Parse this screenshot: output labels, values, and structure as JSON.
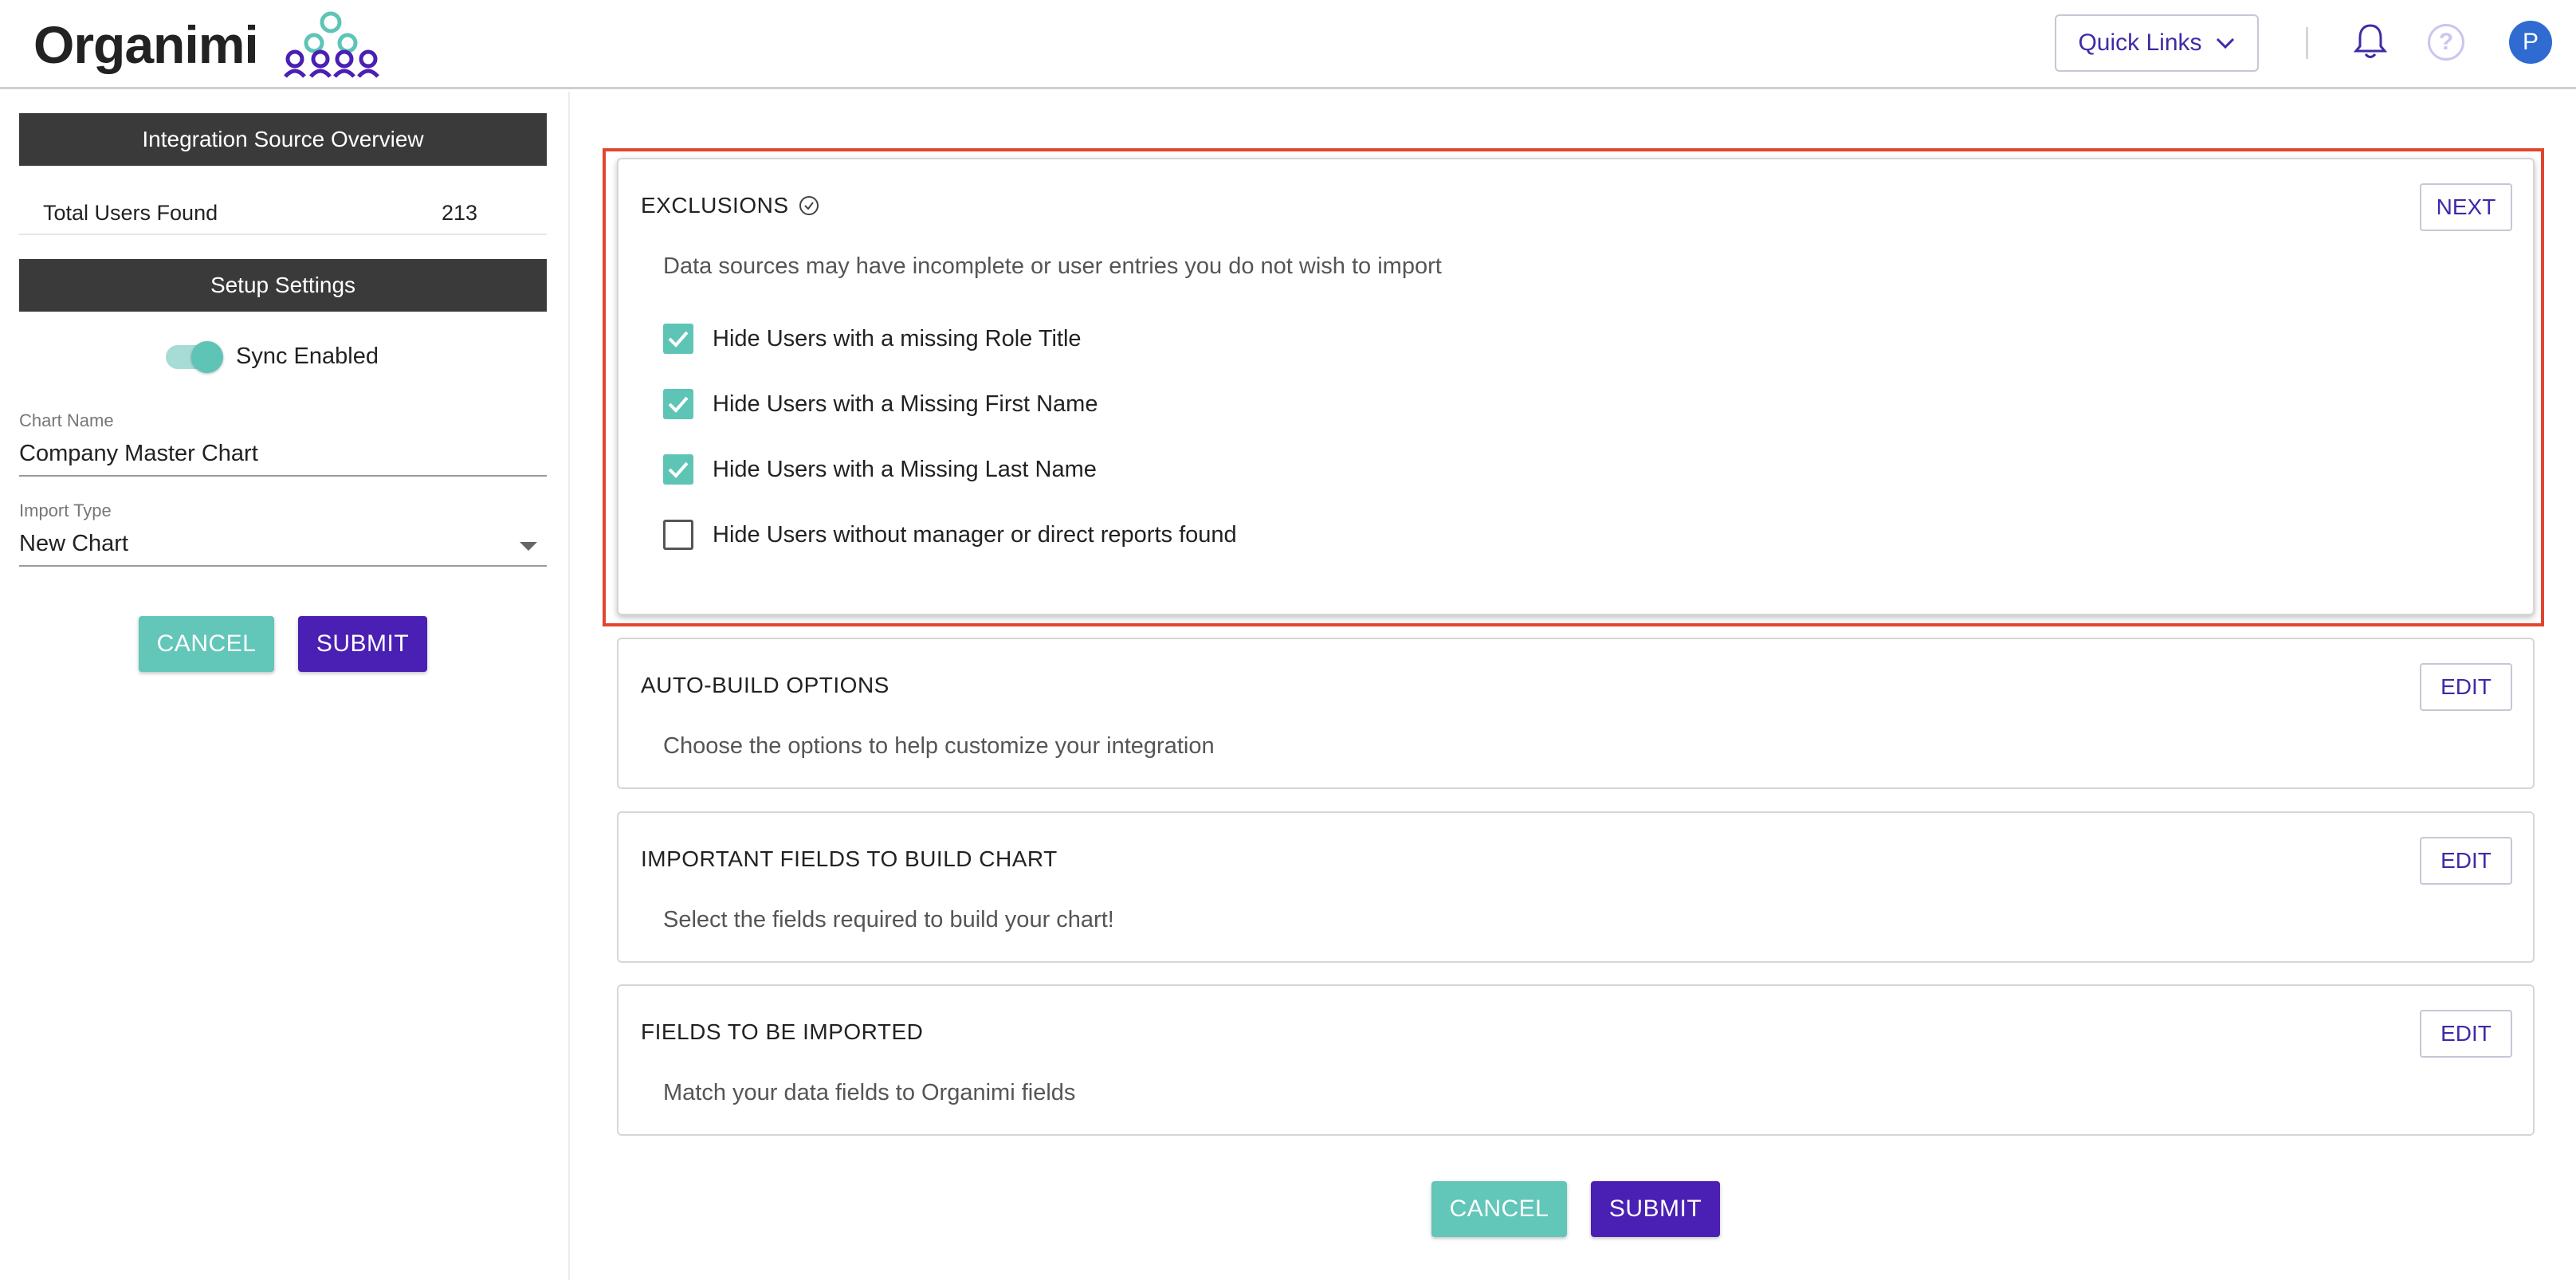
{
  "header": {
    "app_name": "Organimi",
    "quick_links_label": "Quick Links",
    "avatar_initial": "P",
    "help_glyph": "?"
  },
  "sidebar": {
    "overview_title": "Integration Source Overview",
    "total_users_label": "Total Users Found",
    "total_users_value": "213",
    "setup_title": "Setup Settings",
    "sync_label": "Sync Enabled",
    "sync_enabled": true,
    "chart_name_label": "Chart Name",
    "chart_name_value": "Company Master Chart",
    "import_type_label": "Import Type",
    "import_type_value": "New Chart",
    "cancel_label": "CANCEL",
    "submit_label": "SUBMIT"
  },
  "main": {
    "exclusions": {
      "title": "EXCLUSIONS",
      "button": "NEXT",
      "description": "Data sources may have incomplete or user entries you do not wish to import",
      "options": [
        {
          "label": "Hide Users with a missing Role Title",
          "checked": true
        },
        {
          "label": "Hide Users with a Missing First Name",
          "checked": true
        },
        {
          "label": "Hide Users with a Missing Last Name",
          "checked": true
        },
        {
          "label": "Hide Users without manager or direct reports found",
          "checked": false
        }
      ]
    },
    "auto_build": {
      "title": "AUTO-BUILD OPTIONS",
      "button": "EDIT",
      "description": "Choose the options to help customize your integration"
    },
    "important_fields": {
      "title": "IMPORTANT FIELDS TO BUILD CHART",
      "button": "EDIT",
      "description": "Select the fields required to build your chart!"
    },
    "fields_imported": {
      "title": "FIELDS TO BE IMPORTED",
      "button": "EDIT",
      "description": "Match your data fields to Organimi fields"
    },
    "cancel_label": "CANCEL",
    "submit_label": "SUBMIT"
  },
  "colors": {
    "brand_purple": "#4a1fb3",
    "brand_teal": "#62c6b8",
    "highlight_red": "#e2452f",
    "sidebar_header": "#3a3a3a"
  }
}
